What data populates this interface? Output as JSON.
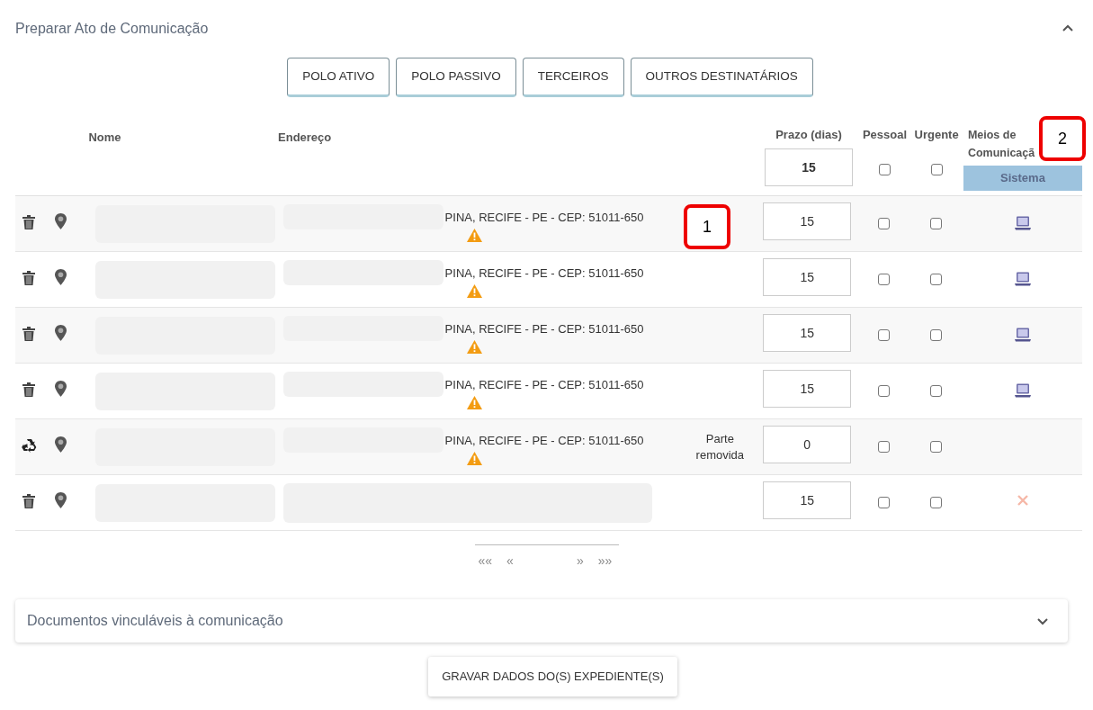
{
  "panel": {
    "title": "Preparar Ato de Comunicação",
    "expanded": true
  },
  "filter_buttons": [
    "POLO ATIVO",
    "POLO PASSIVO",
    "TERCEIROS",
    "OUTROS DESTINATÁRIOS"
  ],
  "table": {
    "headers": {
      "name": "Nome",
      "address": "Endereço",
      "deadline": "Prazo (dias)",
      "personal": "Pessoal",
      "urgent": "Urgente",
      "means": "Meios de Comunicaçã",
      "means_option": "Sistema"
    },
    "defaults": {
      "deadline": "15",
      "personal": false,
      "urgent": false
    },
    "rows": [
      {
        "action": {
          "kind": "delete"
        },
        "address": "PINA, RECIFE - PE - CEP: 51011-650",
        "warning": true,
        "deadline": "15",
        "personal": false,
        "urgent": false,
        "means": {
          "kind": "system"
        }
      },
      {
        "action": {
          "kind": "delete"
        },
        "address": "PINA, RECIFE - PE - CEP: 51011-650",
        "warning": true,
        "deadline": "15",
        "personal": false,
        "urgent": false,
        "means": {
          "kind": "system"
        }
      },
      {
        "action": {
          "kind": "delete"
        },
        "address": "PINA, RECIFE - PE - CEP: 51011-650",
        "warning": true,
        "deadline": "15",
        "personal": false,
        "urgent": false,
        "means": {
          "kind": "system"
        }
      },
      {
        "action": {
          "kind": "delete"
        },
        "address": "PINA, RECIFE - PE - CEP: 51011-650",
        "warning": true,
        "deadline": "15",
        "personal": false,
        "urgent": false,
        "means": {
          "kind": "system"
        }
      },
      {
        "action": {
          "kind": "restore"
        },
        "address": "PINA, RECIFE - PE - CEP: 51011-650",
        "warning": true,
        "note": "Parte removida",
        "deadline": "0",
        "personal": false,
        "urgent": false,
        "means": {
          "kind": "none"
        }
      },
      {
        "action": {
          "kind": "delete"
        },
        "warning": false,
        "deadline": "15",
        "personal": false,
        "urgent": false,
        "means": {
          "kind": "unavailable"
        }
      }
    ]
  },
  "pagination": [
    "««",
    "«",
    "»",
    "»»"
  ],
  "documents_panel": {
    "title": "Documentos vinculáveis à comunicação",
    "expanded": false
  },
  "save_button": "GRAVAR DADOS DO(S) EXPEDIENTE(S)",
  "annotations": [
    {
      "label": "1"
    },
    {
      "label": "2"
    }
  ]
}
